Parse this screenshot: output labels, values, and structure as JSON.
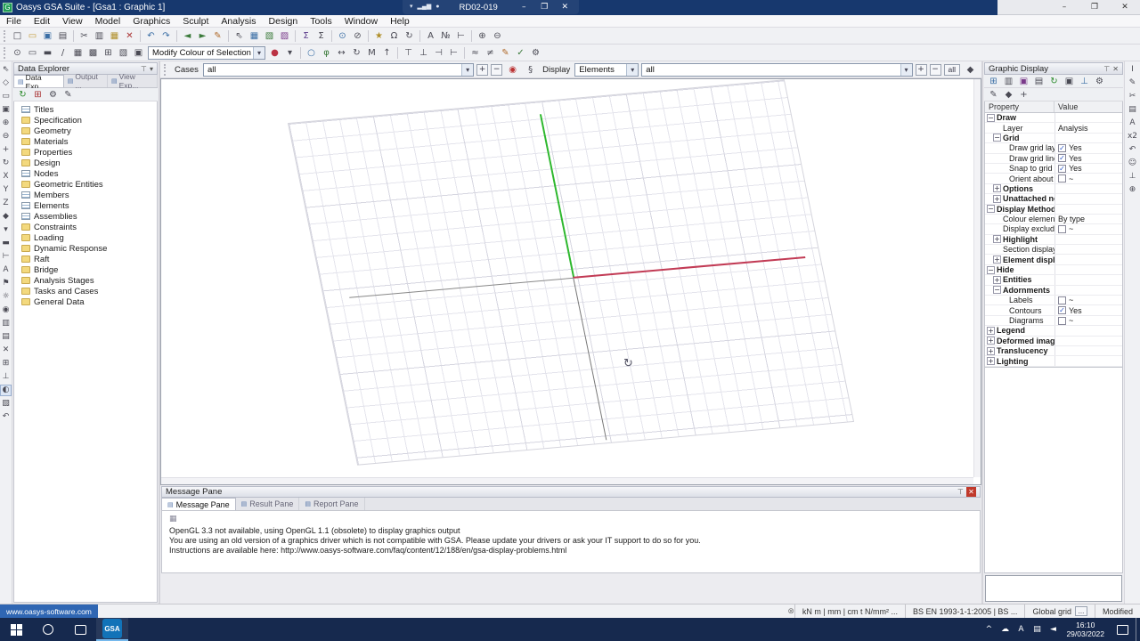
{
  "window": {
    "title": "Oasys GSA Suite - [Gsa1 : Graphic 1]",
    "minimize": "–",
    "maximize": "❐",
    "close": "✕"
  },
  "rdp": {
    "machine": "RD02-019",
    "minimize": "–",
    "restore": "❐",
    "close": "✕",
    "icons": [
      {
        "n": "rdp-pin",
        "g": "▾"
      },
      {
        "n": "rdp-signal",
        "g": "▂▄▆"
      },
      {
        "n": "rdp-lock",
        "g": "●"
      }
    ]
  },
  "menu": {
    "items": [
      "File",
      "Edit",
      "View",
      "Model",
      "Graphics",
      "Sculpt",
      "Analysis",
      "Design",
      "Tools",
      "Window",
      "Help"
    ]
  },
  "toolbar_main": {
    "icons": [
      {
        "n": "new-file",
        "g": "□"
      },
      {
        "n": "open-file",
        "g": "▭",
        "c": "#c59b3a"
      },
      {
        "n": "save",
        "g": "▣",
        "c": "#3a6ea5"
      },
      {
        "n": "print",
        "g": "▤"
      },
      {
        "sep": true
      },
      {
        "n": "cut",
        "g": "✂"
      },
      {
        "n": "copy",
        "g": "▥"
      },
      {
        "n": "paste",
        "g": "▦",
        "c": "#b08f2a"
      },
      {
        "n": "delete",
        "g": "✕",
        "c": "#aa3333"
      },
      {
        "sep": true
      },
      {
        "n": "undo",
        "g": "↶",
        "c": "#3a6ea5"
      },
      {
        "n": "redo",
        "g": "↷",
        "c": "#3a6ea5"
      },
      {
        "sep": true
      },
      {
        "n": "back",
        "g": "◄",
        "c": "#3a7a3a"
      },
      {
        "n": "forward",
        "g": "►",
        "c": "#3a7a3a"
      },
      {
        "n": "format-brush",
        "g": "✎",
        "c": "#b06a2a"
      },
      {
        "sep": true
      },
      {
        "n": "select-cursor",
        "g": "⇖"
      },
      {
        "n": "table-view",
        "g": "▦",
        "c": "#3a6ea5"
      },
      {
        "n": "graphic-view",
        "g": "▧",
        "c": "#3a7a3a"
      },
      {
        "n": "output-view",
        "g": "▨",
        "c": "#7a3a8a"
      },
      {
        "sep": true
      },
      {
        "n": "sum-cases",
        "g": "Σ",
        "c": "#5a3a8a"
      },
      {
        "n": "sum-combinations",
        "g": "Σ"
      },
      {
        "sep": true
      },
      {
        "n": "node-tool",
        "g": "⊙",
        "c": "#3a6ea5"
      },
      {
        "n": "element-tool",
        "g": "⊘"
      },
      {
        "sep": true
      },
      {
        "n": "wand-tool",
        "g": "★",
        "c": "#b08f2a"
      },
      {
        "n": "magnet-tool",
        "g": "Ω"
      },
      {
        "n": "rotate-view",
        "g": "↻"
      },
      {
        "sep": true
      },
      {
        "n": "font",
        "g": "A"
      },
      {
        "n": "label-numbers",
        "g": "№"
      },
      {
        "n": "dimension",
        "g": "⊢"
      },
      {
        "sep": true
      },
      {
        "n": "zoom-in",
        "g": "⊕"
      },
      {
        "n": "zoom-out",
        "g": "⊖"
      }
    ]
  },
  "toolbar_sculpt": {
    "selection_combo": "Modify Colour of Selection",
    "icons_left": [
      {
        "n": "select-nodes",
        "g": "⊙"
      },
      {
        "n": "select-elements",
        "g": "▭"
      },
      {
        "n": "select-members",
        "g": "▬"
      },
      {
        "n": "select-lines",
        "g": "/"
      },
      {
        "n": "select-areas",
        "g": "▦"
      },
      {
        "n": "select-rims",
        "g": "▩"
      },
      {
        "n": "select-grid",
        "g": "⊞"
      },
      {
        "n": "select-cases",
        "g": "▧"
      },
      {
        "n": "select-all",
        "g": "▣"
      }
    ],
    "icons_right": [
      {
        "n": "colour-swatch",
        "g": "●",
        "c": "#bb3344"
      },
      {
        "n": "swatch-caret",
        "g": "▾"
      },
      {
        "sep": true
      },
      {
        "n": "sculpt-node",
        "g": "○",
        "c": "#3a6ea5"
      },
      {
        "n": "sculpt-line",
        "g": "φ",
        "c": "#3a7a3a"
      },
      {
        "n": "move-tool",
        "g": "↔"
      },
      {
        "n": "rotate-tool",
        "g": "↻"
      },
      {
        "n": "mirror-tool",
        "g": "M"
      },
      {
        "n": "extrude-tool",
        "g": "↑"
      },
      {
        "sep": true
      },
      {
        "n": "align-top",
        "g": "⊤"
      },
      {
        "n": "align-bottom",
        "g": "⊥"
      },
      {
        "n": "align-left",
        "g": "⊣"
      },
      {
        "n": "align-right",
        "g": "⊢"
      },
      {
        "sep": true
      },
      {
        "n": "join-tool",
        "g": "≈"
      },
      {
        "n": "split-tool",
        "g": "≠"
      },
      {
        "n": "modify-tool",
        "g": "✎",
        "c": "#b06a2a"
      },
      {
        "n": "check-tool",
        "g": "✓",
        "c": "#3a7a3a"
      },
      {
        "n": "settings-tool",
        "g": "⚙"
      }
    ]
  },
  "left_toolbar": {
    "icons": [
      {
        "n": "pointer",
        "g": "⇖"
      },
      {
        "n": "polyline-select",
        "g": "◇"
      },
      {
        "n": "rect-select",
        "g": "▭"
      },
      {
        "n": "zoom-window",
        "g": "▣"
      },
      {
        "n": "zoom-in",
        "g": "⊕"
      },
      {
        "n": "zoom-out",
        "g": "⊖"
      },
      {
        "n": "pan",
        "g": "+"
      },
      {
        "n": "orbit",
        "g": "↻"
      },
      {
        "n": "view-x",
        "g": "X"
      },
      {
        "n": "view-y",
        "g": "Y"
      },
      {
        "n": "view-z",
        "g": "Z"
      },
      {
        "n": "view-iso",
        "g": "◆"
      },
      {
        "n": "shrink-elements",
        "g": "▾"
      },
      {
        "n": "section-view",
        "g": "▬"
      },
      {
        "n": "measure",
        "g": "⊢"
      },
      {
        "n": "label-tool",
        "g": "A"
      },
      {
        "n": "flag-tool",
        "g": "⚑"
      },
      {
        "n": "sun-tool",
        "g": "☼"
      },
      {
        "n": "camera",
        "g": "◉"
      },
      {
        "n": "copy-image",
        "g": "▥"
      },
      {
        "n": "print-image",
        "g": "▤"
      },
      {
        "n": "erase",
        "g": "✕"
      },
      {
        "n": "grid-toggle",
        "g": "⊞"
      },
      {
        "n": "axes-toggle",
        "g": "⊥"
      },
      {
        "n": "highlight-toggle",
        "g": "◐",
        "active": true
      },
      {
        "n": "volume-clip",
        "g": "▧"
      },
      {
        "n": "reset-view",
        "g": "↶"
      }
    ]
  },
  "right_toolbar": {
    "icons": [
      {
        "n": "cursor-info",
        "g": "I"
      },
      {
        "n": "annotate",
        "g": "✎"
      },
      {
        "n": "cut-section",
        "g": "✂"
      },
      {
        "n": "notes",
        "g": "▤"
      },
      {
        "n": "font-size",
        "g": "A"
      },
      {
        "n": "scale-x2",
        "g": "x2"
      },
      {
        "n": "rotate-ccw",
        "g": "↶"
      },
      {
        "n": "person-view",
        "g": "☺"
      },
      {
        "n": "axis-view",
        "g": "⊥"
      },
      {
        "n": "magnify",
        "g": "⊕"
      }
    ]
  },
  "data_explorer": {
    "title": "Data Explorer",
    "tabs": [
      "Data Exp...",
      "Output ...",
      "View Exp..."
    ],
    "toolbar_icons": [
      {
        "n": "refresh-explorer",
        "g": "↻",
        "c": "#2a8a2a"
      },
      {
        "n": "new-data",
        "g": "⊞",
        "c": "#aa3333"
      },
      {
        "n": "explorer-settings",
        "g": "⚙"
      },
      {
        "n": "explorer-tools",
        "g": "✎"
      }
    ],
    "items": [
      {
        "label": "Titles",
        "icon": "table"
      },
      {
        "label": "Specification",
        "icon": "folder"
      },
      {
        "label": "Geometry",
        "icon": "folder"
      },
      {
        "label": "Materials",
        "icon": "folder"
      },
      {
        "label": "Properties",
        "icon": "folder"
      },
      {
        "label": "Design",
        "icon": "folder"
      },
      {
        "label": "Nodes",
        "icon": "table"
      },
      {
        "label": "Geometric Entities",
        "icon": "folder"
      },
      {
        "label": "Members",
        "icon": "table"
      },
      {
        "label": "Elements",
        "icon": "table"
      },
      {
        "label": "Assemblies",
        "icon": "table"
      },
      {
        "label": "Constraints",
        "icon": "folder"
      },
      {
        "label": "Loading",
        "icon": "folder"
      },
      {
        "label": "Dynamic Response",
        "icon": "folder"
      },
      {
        "label": "Raft",
        "icon": "folder"
      },
      {
        "label": "Bridge",
        "icon": "folder"
      },
      {
        "label": "Analysis Stages",
        "icon": "folder"
      },
      {
        "label": "Tasks and Cases",
        "icon": "folder"
      },
      {
        "label": "General Data",
        "icon": "folder"
      }
    ]
  },
  "cases_bar": {
    "cases_label": "Cases",
    "cases_value": "all",
    "display_label": "Display",
    "display_value": "Elements",
    "filter_value": "all",
    "all_button": "all"
  },
  "graphic_display": {
    "title": "Graphic Display",
    "property_header": "Property",
    "value_header": "Value",
    "toolbar_icons": [
      {
        "n": "new-graphic-view",
        "g": "⊞",
        "c": "#3a6ea5"
      },
      {
        "n": "copy-graphic",
        "g": "▥"
      },
      {
        "n": "save-graphic",
        "g": "▣",
        "c": "#7a3a8a"
      },
      {
        "n": "print-graphic",
        "g": "▤"
      },
      {
        "n": "refresh-graphic",
        "g": "↻",
        "c": "#2a8a2a"
      },
      {
        "n": "zoom-extents",
        "g": "▣"
      },
      {
        "n": "toggle-axes",
        "g": "⊥",
        "c": "#3a6ea5"
      },
      {
        "n": "graphic-settings",
        "g": "⚙"
      }
    ],
    "toolbar_icons2": [
      {
        "n": "edit-properties",
        "g": "✎"
      },
      {
        "n": "probe-values",
        "g": "◆"
      },
      {
        "n": "dock-pane",
        "g": "+"
      }
    ],
    "rows": [
      {
        "label": "Draw",
        "bold": true,
        "expand": "minus",
        "indent": 0
      },
      {
        "label": "Layer",
        "indent": 1,
        "value": "Analysis"
      },
      {
        "label": "Grid",
        "bold": true,
        "expand": "minus",
        "indent": 1
      },
      {
        "label": "Draw grid lay...",
        "indent": 2,
        "check": "checked",
        "value": "Yes"
      },
      {
        "label": "Draw grid lines",
        "indent": 2,
        "check": "checked",
        "value": "Yes"
      },
      {
        "label": "Snap to grid",
        "indent": 2,
        "check": "checked",
        "value": "Yes"
      },
      {
        "label": "Orient about ...",
        "indent": 2,
        "check": "unchecked",
        "value": "~"
      },
      {
        "label": "Options",
        "bold": true,
        "expand": "plus",
        "indent": 1
      },
      {
        "label": "Unattached nodes",
        "bold": true,
        "expand": "plus",
        "indent": 1
      },
      {
        "label": "Display Methods",
        "bold": true,
        "expand": "minus",
        "indent": 0
      },
      {
        "label": "Colour elements",
        "indent": 1,
        "value": "By type"
      },
      {
        "label": "Display excluded...",
        "indent": 1,
        "check": "unchecked",
        "value": "~"
      },
      {
        "label": "Highlight",
        "bold": true,
        "expand": "plus",
        "indent": 1
      },
      {
        "label": "Section display",
        "indent": 1,
        "value": ""
      },
      {
        "label": "Element display",
        "bold": true,
        "expand": "plus",
        "indent": 1
      },
      {
        "label": "Hide",
        "bold": true,
        "expand": "minus",
        "indent": 0
      },
      {
        "label": "Entities",
        "bold": true,
        "expand": "plus",
        "indent": 1
      },
      {
        "label": "Adornments",
        "bold": true,
        "expand": "minus",
        "indent": 1
      },
      {
        "label": "Labels",
        "indent": 2,
        "check": "unchecked",
        "value": "~"
      },
      {
        "label": "Contours",
        "indent": 2,
        "check": "checked",
        "value": "Yes"
      },
      {
        "label": "Diagrams",
        "indent": 2,
        "check": "unchecked",
        "value": "~"
      },
      {
        "label": "Legend",
        "bold": true,
        "expand": "plus",
        "indent": 0
      },
      {
        "label": "Deformed image",
        "bold": true,
        "expand": "plus",
        "indent": 0
      },
      {
        "label": "Translucency",
        "bold": true,
        "expand": "plus",
        "indent": 0
      },
      {
        "label": "Lighting",
        "bold": true,
        "expand": "plus",
        "indent": 0
      }
    ]
  },
  "message_pane": {
    "title": "Message Pane",
    "tabs": [
      {
        "label": "Message Pane"
      },
      {
        "label": "Result Pane"
      },
      {
        "label": "Report Pane"
      }
    ],
    "lines": [
      "OpenGL 3.3 not available, using OpenGL 1.1 (obsolete) to display graphics output",
      "You are using an old version of a graphics driver which is not compatible with GSA. Please update your drivers or ask your IT support to do so for you.",
      "Instructions are available here: http://www.oasys-software.com/faq/content/12/188/en/gsa-display-problems.html"
    ]
  },
  "status_bar": {
    "link": "www.oasys-software.com",
    "units": "kN m | mm | cm t N/mm² ...",
    "design_code": "BS EN 1993-1-1:2005 | BS ...",
    "grid": "Global grid",
    "more": "...",
    "state": "Modified"
  },
  "taskbar": {
    "app_label": "GSA",
    "time": "16:10",
    "date": "29/03/2022",
    "tray_icons": [
      {
        "n": "tray-expand",
        "g": "^"
      },
      {
        "n": "onedrive",
        "g": "☁"
      },
      {
        "n": "language",
        "g": "A"
      },
      {
        "n": "network",
        "g": "▤"
      },
      {
        "n": "volume",
        "g": "◄"
      }
    ]
  },
  "colors": {
    "titlebar": "#17386e",
    "taskbar": "#16294e",
    "axis_green": "#2eb82e",
    "axis_red": "#c23b55",
    "app_accent": "#1273b8"
  }
}
